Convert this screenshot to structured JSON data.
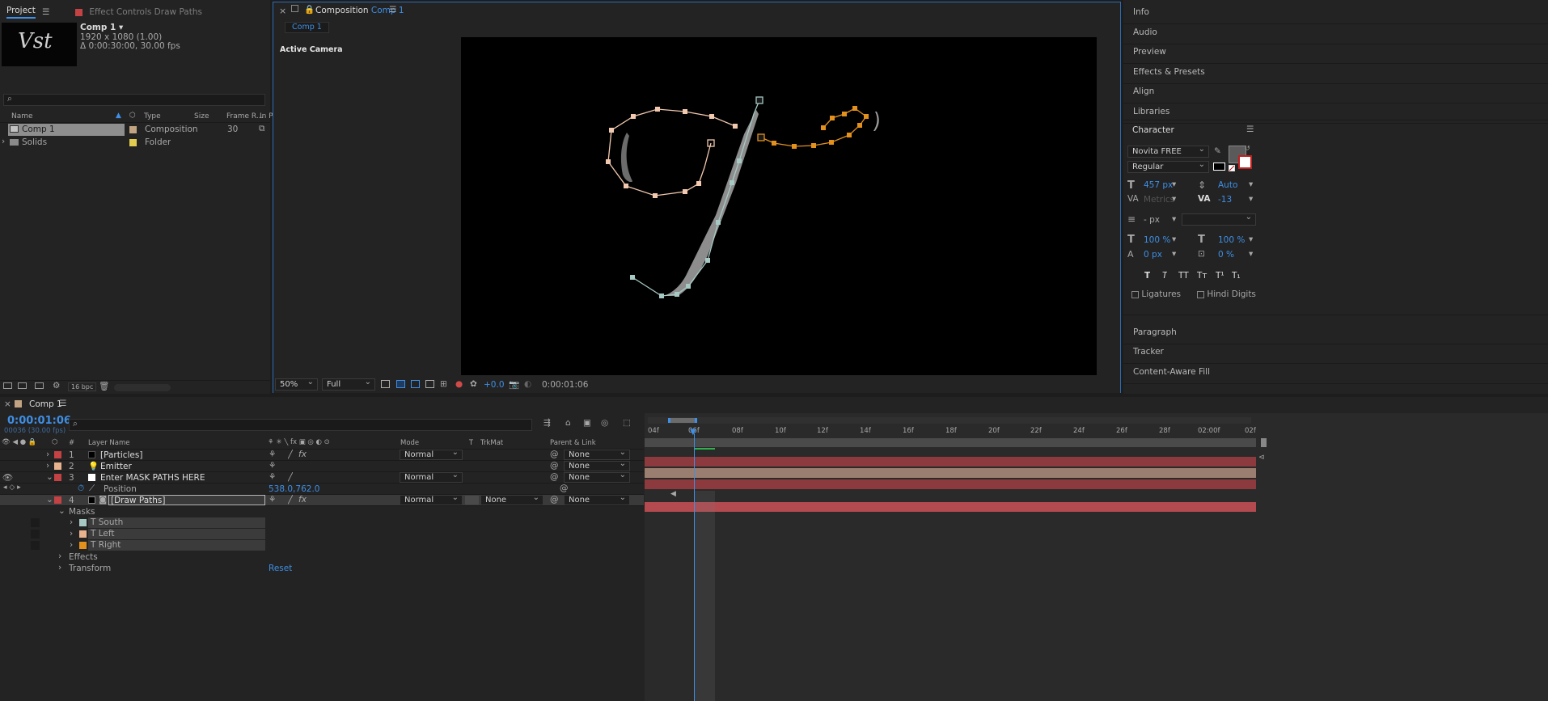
{
  "project": {
    "tab_label": "Project",
    "effect_tab_label": "Effect Controls Draw Paths",
    "thumb_text": "Vst",
    "item_name": "Comp 1 ▾",
    "item_res": "1920 x 1080 (1.00)",
    "item_dur": "Δ 0:00:30:00, 30.00 fps",
    "search_icon": "search-icon",
    "columns": {
      "name": "Name",
      "type": "Type",
      "size": "Size",
      "frame_rate": "Frame R...",
      "in": "In P"
    },
    "items": [
      {
        "name": "Comp 1",
        "type": "Composition",
        "rate": "30",
        "color": "#c2a382"
      },
      {
        "name": "Solids",
        "type": "Folder",
        "rate": "",
        "color": "#e2cd50"
      }
    ],
    "bpc": "16 bpc"
  },
  "viewer": {
    "tab_label": "Composition",
    "tab_comp": "Comp 1",
    "breadcrumb": "Comp 1",
    "camera_label": "Active Camera",
    "zoom": "50%",
    "resolution": "Full",
    "exposure": "+0.0",
    "timecode": "0:00:01:06"
  },
  "right_panel": {
    "items_top": [
      "Info",
      "Audio",
      "Preview",
      "Effects & Presets",
      "Align",
      "Libraries"
    ],
    "character_title": "Character",
    "font_family": "Novita FREE",
    "font_style": "Regular",
    "font_size": "457",
    "font_size_unit": "px",
    "leading": "Auto",
    "kerning": "Metrics",
    "tracking": "-13",
    "stroke_width": "-",
    "stroke_unit": "px",
    "vscale": "100",
    "vscale_unit": "%",
    "hscale": "100",
    "hscale_unit": "%",
    "baseline": "0",
    "baseline_unit": "px",
    "tsume": "0",
    "tsume_unit": "%",
    "style_buttons": [
      "T",
      "T",
      "TT",
      "Tт",
      "T¹",
      "T₁"
    ],
    "ligatures": "Ligatures",
    "hindi_digits": "Hindi Digits",
    "items_bottom": [
      "Paragraph",
      "Tracker",
      "Content-Aware Fill"
    ]
  },
  "timeline": {
    "tab_label": "Comp 1",
    "timecode": "0:00:01:06",
    "frame_info": "00036 (30.00 fps)",
    "columns": {
      "layer_name": "Layer Name",
      "mode": "Mode",
      "t": "T",
      "trkmat": "TrkMat",
      "parent": "Parent & Link"
    },
    "ruler": [
      "04f",
      "06f",
      "08f",
      "10f",
      "12f",
      "14f",
      "16f",
      "18f",
      "20f",
      "22f",
      "24f",
      "26f",
      "28f",
      "02:00f",
      "02f"
    ],
    "layers": [
      {
        "num": "1",
        "name": "[Particles]",
        "label_color": "#c44244",
        "mode": "Normal",
        "parent": "None",
        "bar_color": "#8c3a3e"
      },
      {
        "num": "2",
        "name": "Emitter",
        "label_color": "#e8b28f",
        "mode": "",
        "parent": "None",
        "bar_color": "#9a7f70"
      },
      {
        "num": "3",
        "name": "Enter MASK PATHS HERE",
        "label_color": "#c44244",
        "mode": "Normal",
        "parent": "None",
        "bar_color": "#8c3a3e"
      },
      {
        "num": "4",
        "name": "[Draw Paths]",
        "label_color": "#c44244",
        "mode": "Normal",
        "trkmat": "None",
        "parent": "None",
        "bar_color": "#b24a50"
      }
    ],
    "position_label": "Position",
    "position_value": "538.0,762.0",
    "masks_label": "Masks",
    "masks": [
      {
        "name": "South",
        "color": "#a7c9c4"
      },
      {
        "name": "Left",
        "color": "#e8b28f"
      },
      {
        "name": "Right",
        "color": "#e3901d"
      }
    ],
    "effects_label": "Effects",
    "transform_label": "Transform",
    "reset_label": "Reset"
  }
}
